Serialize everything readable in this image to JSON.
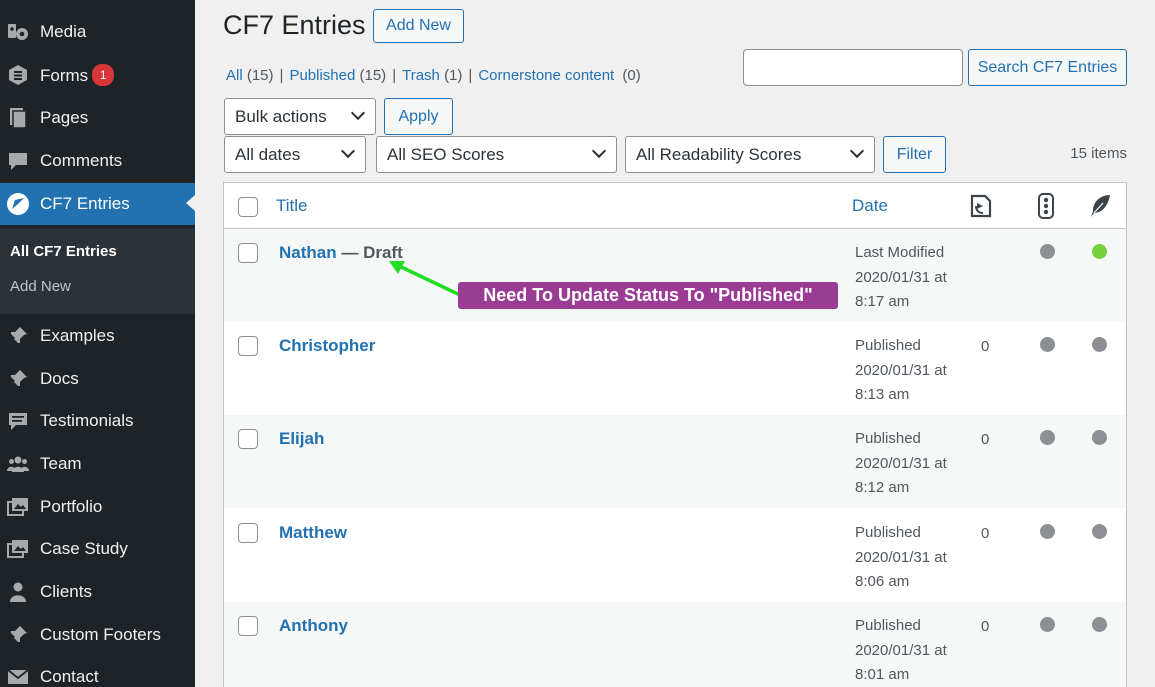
{
  "sidebar": {
    "items": [
      {
        "label": "Media",
        "icon": "media-icon"
      },
      {
        "label": "Forms",
        "icon": "forms-icon",
        "badge": "1"
      },
      {
        "label": "Pages",
        "icon": "pages-icon"
      },
      {
        "label": "Comments",
        "icon": "comments-icon"
      },
      {
        "label": "CF7 Entries",
        "icon": "cf7-entries-icon",
        "active": true
      },
      {
        "label": "Examples",
        "icon": "pin-icon"
      },
      {
        "label": "Docs",
        "icon": "pin-icon"
      },
      {
        "label": "Testimonials",
        "icon": "testimonials-icon"
      },
      {
        "label": "Team",
        "icon": "team-icon"
      },
      {
        "label": "Portfolio",
        "icon": "portfolio-icon"
      },
      {
        "label": "Case Study",
        "icon": "case-study-icon"
      },
      {
        "label": "Clients",
        "icon": "clients-icon"
      },
      {
        "label": "Custom Footers",
        "icon": "pin-icon"
      },
      {
        "label": "Contact",
        "icon": "mail-icon"
      }
    ],
    "submenu": [
      {
        "label": "All CF7 Entries",
        "current": true
      },
      {
        "label": "Add New",
        "current": false
      }
    ]
  },
  "header": {
    "title": "CF7 Entries",
    "add_new_label": "Add New"
  },
  "filters": {
    "views": [
      {
        "label": "All",
        "count": "(15)"
      },
      {
        "label": "Published",
        "count": "(15)"
      },
      {
        "label": "Trash",
        "count": "(1)"
      },
      {
        "label": "Cornerstone content",
        "count": "(0)"
      }
    ],
    "search_button": "Search CF7 Entries",
    "search_value": "",
    "bulk_actions": "Bulk actions",
    "apply": "Apply",
    "dates": "All dates",
    "seo": "All SEO Scores",
    "readability": "All Readability Scores",
    "filter": "Filter",
    "items_count": "15 items"
  },
  "table": {
    "columns": {
      "title": "Title",
      "date": "Date"
    },
    "rows": [
      {
        "title": "Nathan",
        "state": " — Draft",
        "date_status": "Last Modified",
        "date": "2020/01/31 at",
        "time": "8:17 am",
        "links": "",
        "seo_color": "#8c8f94",
        "read_color": "#7ad03a"
      },
      {
        "title": "Christopher",
        "state": "",
        "date_status": "Published",
        "date": "2020/01/31 at",
        "time": "8:13 am",
        "links": "0",
        "seo_color": "#8c8f94",
        "read_color": "#8c8f94"
      },
      {
        "title": "Elijah",
        "state": "",
        "date_status": "Published",
        "date": "2020/01/31 at",
        "time": "8:12 am",
        "links": "0",
        "seo_color": "#8c8f94",
        "read_color": "#8c8f94"
      },
      {
        "title": "Matthew",
        "state": "",
        "date_status": "Published",
        "date": "2020/01/31 at",
        "time": "8:06 am",
        "links": "0",
        "seo_color": "#8c8f94",
        "read_color": "#8c8f94"
      },
      {
        "title": "Anthony",
        "state": "",
        "date_status": "Published",
        "date": "2020/01/31 at",
        "time": "8:01 am",
        "links": "0",
        "seo_color": "#8c8f94",
        "read_color": "#8c8f94"
      }
    ]
  },
  "annotation": {
    "text": "Need To Update Status To \"Published\"",
    "arrow_color": "#22dd22"
  }
}
